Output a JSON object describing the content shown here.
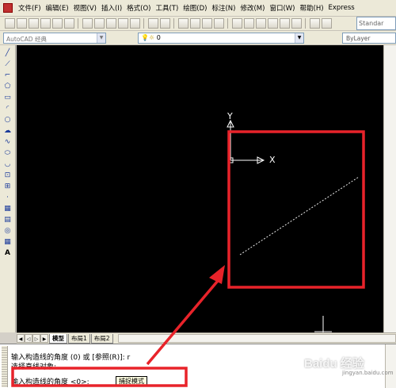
{
  "menu": {
    "items": [
      "文件(F)",
      "编辑(E)",
      "视图(V)",
      "插入(I)",
      "格式(O)",
      "工具(T)",
      "绘图(D)",
      "标注(N)",
      "修改(M)",
      "窗口(W)",
      "帮助(H)",
      "Express"
    ]
  },
  "toolbar": {
    "style_combo": "Standar"
  },
  "workspace": {
    "combo_value": "AutoCAD 经典",
    "layer_value": "0",
    "color_value": "ByLayer"
  },
  "draw_tools": {
    "text_tool_label": "A"
  },
  "canvas": {
    "ucs_y_label": "Y",
    "ucs_x_label": "X"
  },
  "tabs": {
    "items": [
      "模型",
      "布局1",
      "布局2"
    ],
    "active": "模型"
  },
  "command": {
    "history_line1": "输入构造线的角度 (0) 或 [参照(R)]: r",
    "history_line2": "选择直线对象:",
    "prompt": "输入构造线的角度 <0>:",
    "snap_tooltip": "捕捉模式"
  },
  "annotation": {
    "highlight_color": "#e8232a",
    "watermark": "Baidu 经验",
    "watermark_sub": "jingyan.baidu.com"
  }
}
